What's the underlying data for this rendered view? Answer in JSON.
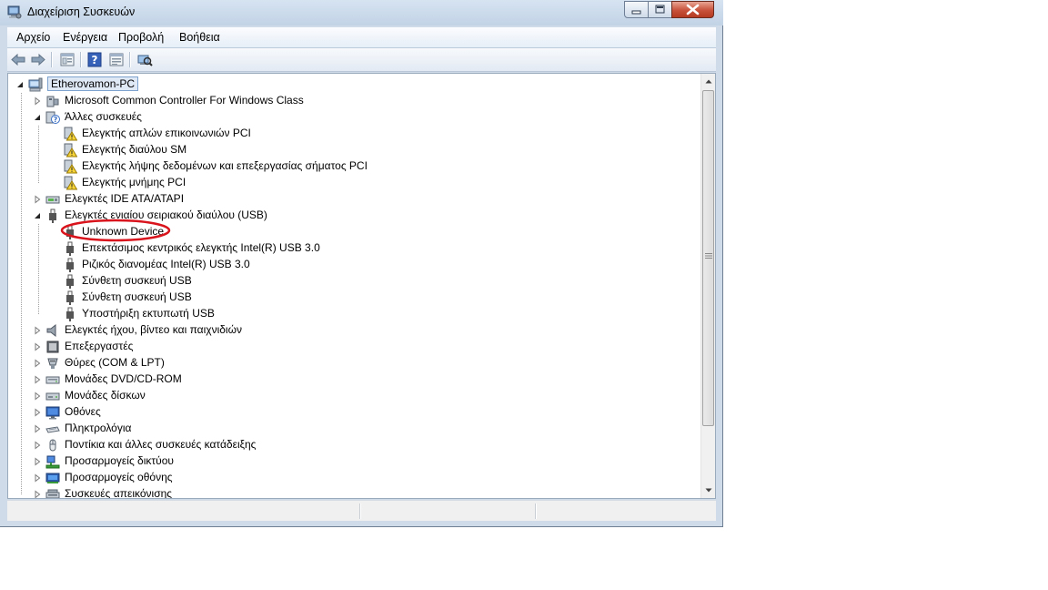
{
  "window": {
    "title": "Διαχείριση Συσκευών",
    "title_icon": "device-manager-icon"
  },
  "menu": [
    "Αρχείο",
    "Ενέργεια",
    "Προβολή",
    "Βοήθεια"
  ],
  "toolbar": {
    "icons": [
      "back-arrow-icon",
      "forward-arrow-icon",
      "properties-icon",
      "help-icon",
      "show-hidden-icon",
      "scan-hardware-icon"
    ]
  },
  "tree": [
    {
      "label": "Etherovamon-PC",
      "level": 0,
      "toggle": "expanded",
      "icon": "computer-icon",
      "selected": true
    },
    {
      "label": "Microsoft Common Controller For Windows Class",
      "level": 1,
      "toggle": "collapsed",
      "icon": "controller-icon"
    },
    {
      "label": "Άλλες συσκευές",
      "level": 1,
      "toggle": "expanded",
      "icon": "unknown-device-icon"
    },
    {
      "label": "Ελεγκτής απλών επικοινωνιών PCI",
      "level": 2,
      "toggle": "none",
      "icon": "warning-device-icon"
    },
    {
      "label": "Ελεγκτής διαύλου SM",
      "level": 2,
      "toggle": "none",
      "icon": "warning-device-icon"
    },
    {
      "label": "Ελεγκτής λήψης δεδομένων και επεξεργασίας σήματος PCI",
      "level": 2,
      "toggle": "none",
      "icon": "warning-device-icon"
    },
    {
      "label": "Ελεγκτής μνήμης PCI",
      "level": 2,
      "toggle": "none",
      "icon": "warning-device-icon"
    },
    {
      "label": "Ελεγκτές IDE ATA/ATAPI",
      "level": 1,
      "toggle": "collapsed",
      "icon": "ide-controller-icon"
    },
    {
      "label": "Ελεγκτές ενιαίου σειριακού διαύλου (USB)",
      "level": 1,
      "toggle": "expanded",
      "icon": "usb-plug-icon"
    },
    {
      "label": "Unknown Device",
      "level": 2,
      "toggle": "none",
      "icon": "usb-plug-icon"
    },
    {
      "label": "Επεκτάσιμος κεντρικός ελεγκτής Intel(R) USB 3.0",
      "level": 2,
      "toggle": "none",
      "icon": "usb-plug-icon"
    },
    {
      "label": "Ριζικός διανομέας Intel(R) USB 3.0",
      "level": 2,
      "toggle": "none",
      "icon": "usb-plug-icon"
    },
    {
      "label": "Σύνθετη συσκευή USB",
      "level": 2,
      "toggle": "none",
      "icon": "usb-plug-icon"
    },
    {
      "label": "Σύνθετη συσκευή USB",
      "level": 2,
      "toggle": "none",
      "icon": "usb-plug-icon"
    },
    {
      "label": "Υποστήριξη εκτυπωτή USB",
      "level": 2,
      "toggle": "none",
      "icon": "usb-plug-icon"
    },
    {
      "label": "Ελεγκτές ήχου, βίντεο και παιχνιδιών",
      "level": 1,
      "toggle": "collapsed",
      "icon": "speaker-icon"
    },
    {
      "label": "Επεξεργαστές",
      "level": 1,
      "toggle": "collapsed",
      "icon": "processor-icon"
    },
    {
      "label": "Θύρες (COM & LPT)",
      "level": 1,
      "toggle": "collapsed",
      "icon": "port-icon"
    },
    {
      "label": "Μονάδες DVD/CD-ROM",
      "level": 1,
      "toggle": "collapsed",
      "icon": "dvd-drive-icon"
    },
    {
      "label": "Μονάδες δίσκων",
      "level": 1,
      "toggle": "collapsed",
      "icon": "disk-drive-icon"
    },
    {
      "label": "Οθόνες",
      "level": 1,
      "toggle": "collapsed",
      "icon": "monitor-icon"
    },
    {
      "label": "Πληκτρολόγια",
      "level": 1,
      "toggle": "collapsed",
      "icon": "keyboard-icon"
    },
    {
      "label": "Ποντίκια και άλλες συσκευές κατάδειξης",
      "level": 1,
      "toggle": "collapsed",
      "icon": "mouse-icon"
    },
    {
      "label": "Προσαρμογείς δικτύου",
      "level": 1,
      "toggle": "collapsed",
      "icon": "network-adapter-icon"
    },
    {
      "label": "Προσαρμογείς οθόνης",
      "level": 1,
      "toggle": "collapsed",
      "icon": "display-adapter-icon"
    },
    {
      "label": "Συσκευές απεικόνισης",
      "level": 1,
      "toggle": "collapsed",
      "icon": "imaging-device-icon"
    }
  ],
  "annotation": {
    "target": "Unknown Device",
    "color": "#d9141c"
  }
}
